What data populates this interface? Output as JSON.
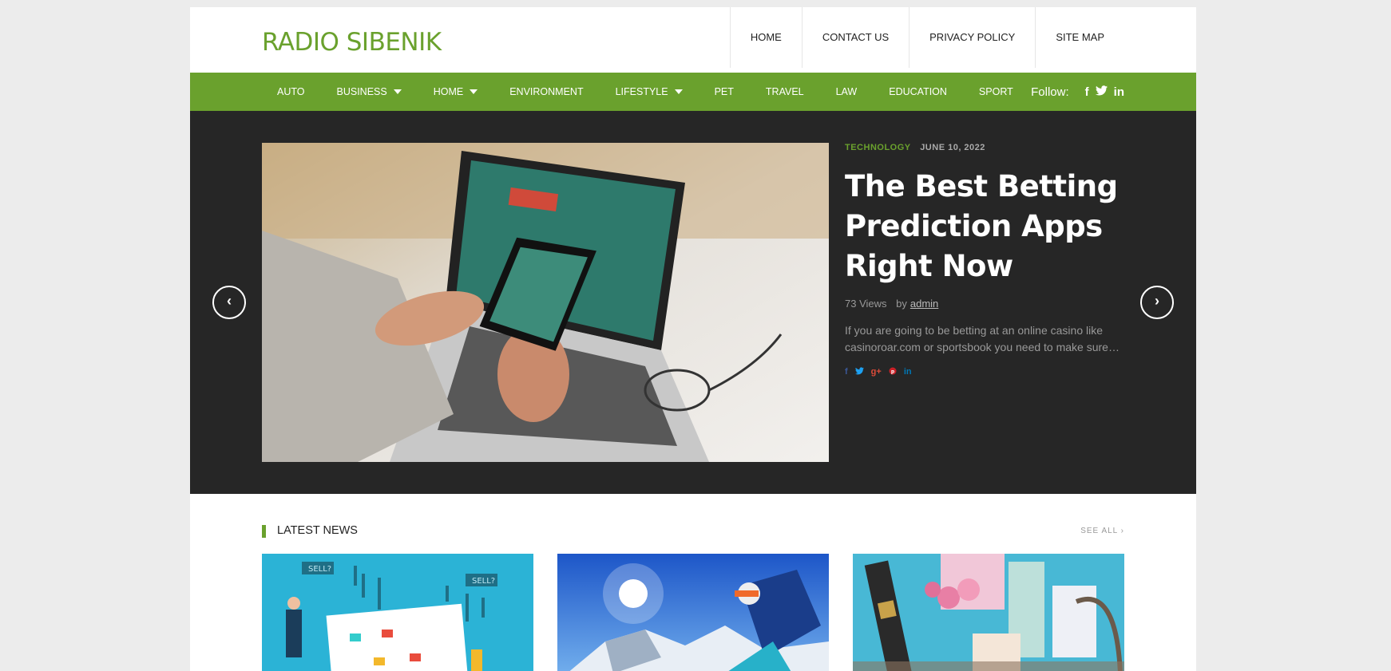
{
  "site": {
    "title": "RADIO SIBENIK"
  },
  "top_menu": [
    {
      "label": "HOME"
    },
    {
      "label": "CONTACT US"
    },
    {
      "label": "PRIVACY POLICY"
    },
    {
      "label": "SITE MAP"
    }
  ],
  "nav": {
    "items": [
      {
        "label": "AUTO",
        "dropdown": false
      },
      {
        "label": "BUSINESS",
        "dropdown": true
      },
      {
        "label": "HOME",
        "dropdown": true
      },
      {
        "label": "ENVIRONMENT",
        "dropdown": false
      },
      {
        "label": "LIFESTYLE",
        "dropdown": true
      },
      {
        "label": "PET",
        "dropdown": false
      },
      {
        "label": "TRAVEL",
        "dropdown": false
      },
      {
        "label": "LAW",
        "dropdown": false
      },
      {
        "label": "EDUCATION",
        "dropdown": false
      },
      {
        "label": "SPORT",
        "dropdown": false
      }
    ],
    "follow_label": "Follow:",
    "social_icons": [
      "facebook-icon",
      "twitter-icon",
      "linkedin-icon"
    ]
  },
  "slider": {
    "category": "TECHNOLOGY",
    "date": "JUNE 10, 2022",
    "title": "The Best Betting Prediction Apps Right Now",
    "views": "73 Views",
    "by": "by",
    "author": "admin",
    "excerpt": "If you are going to be betting at an online casino like casinoroar.com or sportsbook you need to make sure…",
    "dot_count": 3,
    "active_dot": 0,
    "share_icons": [
      "facebook-icon",
      "twitter-icon",
      "google-plus-icon",
      "pinterest-icon",
      "linkedin-icon"
    ]
  },
  "latest": {
    "title": "LATEST NEWS",
    "see_all": "SEE ALL ›"
  },
  "colors": {
    "accent": "#6aa12d",
    "slider_bg": "#262626"
  }
}
